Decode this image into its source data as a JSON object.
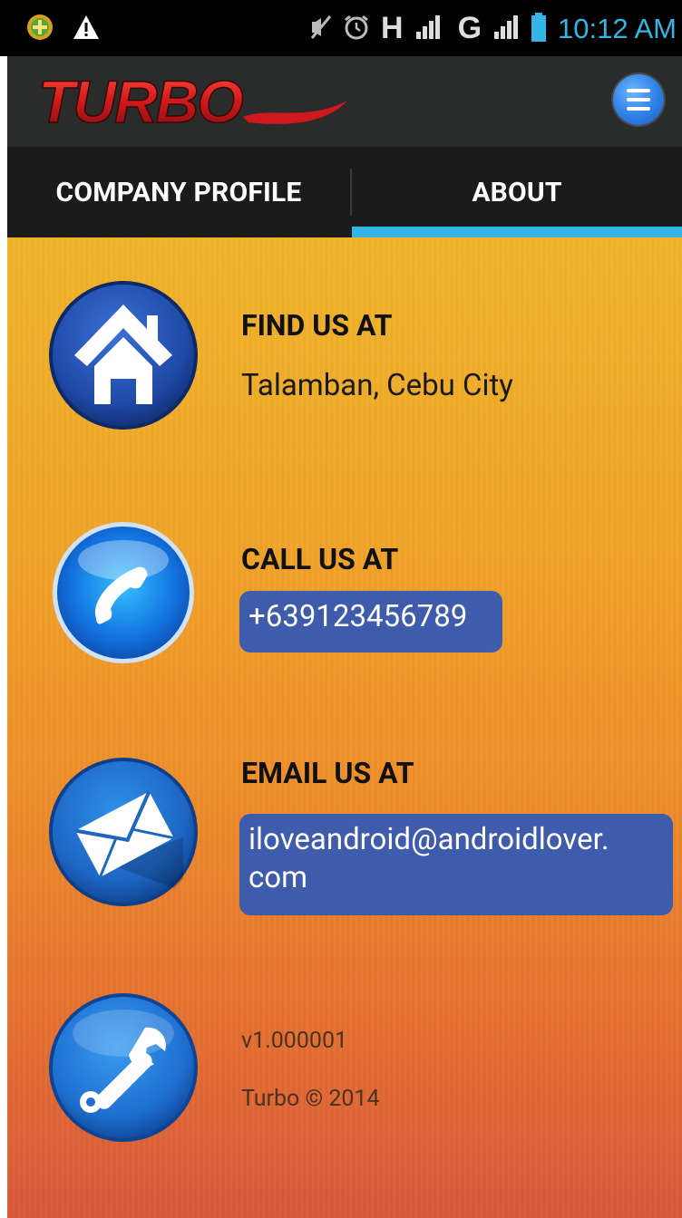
{
  "status_bar": {
    "time": "10:12 AM",
    "network_1": "H",
    "network_2": "G",
    "icons": [
      "download-icon",
      "warning-icon",
      "mute-icon",
      "alarm-icon",
      "signal-icon",
      "battery-icon"
    ]
  },
  "app": {
    "logo_text": "TURBO"
  },
  "tabs": [
    {
      "label": "COMPANY PROFILE",
      "selected": false
    },
    {
      "label": "ABOUT",
      "selected": true
    }
  ],
  "about": {
    "find": {
      "heading": "FIND US AT",
      "value": "Talamban, Cebu City"
    },
    "call": {
      "heading": "CALL US AT",
      "value": "+639123456789"
    },
    "email": {
      "heading": "EMAIL US AT",
      "value_line1": "iloveandroid@androidlover.",
      "value_line2": "com"
    },
    "version": "v1.000001",
    "copyright": "Turbo © 2014"
  },
  "colors": {
    "tab_indicator": "#33b5e5",
    "pill_background": "#3f5bab",
    "status_time": "#34b5e5",
    "logo_red": "#d0191c"
  }
}
